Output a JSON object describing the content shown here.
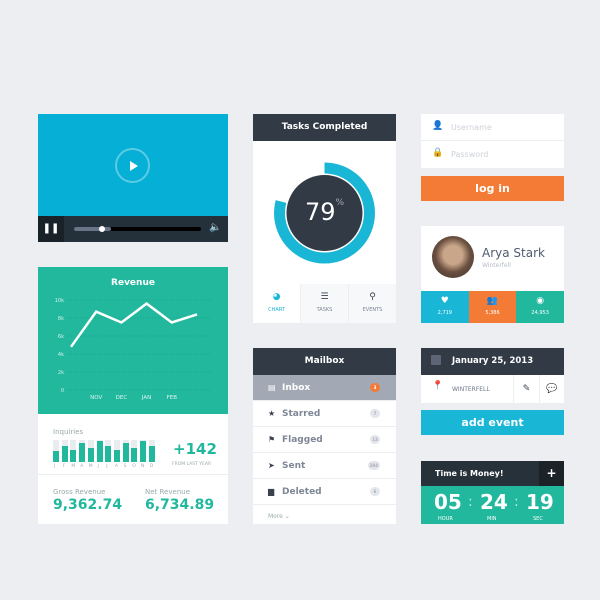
{
  "video": {
    "progress": 0.22,
    "buffered": 0.29,
    "icons": [
      "play-icon",
      "pause-icon",
      "volume-icon"
    ]
  },
  "revenue": {
    "title": "Revenue",
    "inquiries_label": "Inquiries",
    "months": [
      "J",
      "F",
      "M",
      "A",
      "M",
      "J",
      "J",
      "A",
      "S",
      "O",
      "N",
      "D"
    ],
    "inquiries": [
      0.5,
      0.75,
      0.55,
      0.85,
      0.65,
      0.95,
      0.75,
      0.55,
      0.85,
      0.65,
      0.95,
      0.75
    ],
    "change": "+142",
    "change_label": "FROM LAST YEAR",
    "gross_label": "Gross Revenue",
    "gross": "9,362.74",
    "net_label": "Net Revenue",
    "net": "6,734.89"
  },
  "chart_data": {
    "type": "line",
    "title": "Revenue",
    "categories": [
      "",
      "NOV",
      "DEC",
      "JAN",
      "FEB",
      ""
    ],
    "values": [
      4800,
      8700,
      7500,
      9600,
      7500,
      8400
    ],
    "yticks": [
      "0",
      "2k",
      "4k",
      "6k",
      "8k",
      "10k"
    ],
    "ylim": [
      0,
      10000
    ],
    "grid": true
  },
  "tasks": {
    "title": "Tasks Completed",
    "value": 79,
    "value_text": "79",
    "unit": "%",
    "tabs": [
      {
        "label": "CHART",
        "icon": "pie-chart-icon",
        "active": true
      },
      {
        "label": "TASKS",
        "icon": "list-icon"
      },
      {
        "label": "EVENTS",
        "icon": "map-pin-icon"
      }
    ]
  },
  "mailbox": {
    "title": "Mailbox",
    "items": [
      {
        "label": "Inbox",
        "count": "3",
        "icon": "inbox-icon"
      },
      {
        "label": "Starred",
        "count": "7",
        "icon": "star-icon"
      },
      {
        "label": "Flagged",
        "count": "13",
        "icon": "flag-icon"
      },
      {
        "label": "Sent",
        "count": "284",
        "icon": "send-icon"
      },
      {
        "label": "Deleted",
        "count": "6",
        "icon": "trash-icon"
      }
    ],
    "more": "More ⌄"
  },
  "login": {
    "username_placeholder": "Username",
    "password_placeholder": "Password",
    "button": "log in"
  },
  "profile": {
    "name": "Arya Stark",
    "location": "Winterfell",
    "stats": [
      {
        "value": "2,719",
        "icon": "heart-icon",
        "color": "#1ab6d6"
      },
      {
        "value": "5,386",
        "icon": "users-icon",
        "color": "#f47b35"
      },
      {
        "value": "24,953",
        "icon": "eye-icon",
        "color": "#21b89e"
      }
    ]
  },
  "event": {
    "date": "January 25, 2013",
    "location": "WINTERFELL",
    "button": "add event"
  },
  "timer": {
    "title": "Time is Money!",
    "hour": "05",
    "min": "24",
    "sec": "19",
    "hour_label": "HOUR",
    "min_label": "MIN",
    "sec_label": "SEC"
  },
  "colors": {
    "cyan": "#1ab6d6",
    "teal": "#21b89e",
    "orange": "#f47b35",
    "dark": "#323a46"
  }
}
